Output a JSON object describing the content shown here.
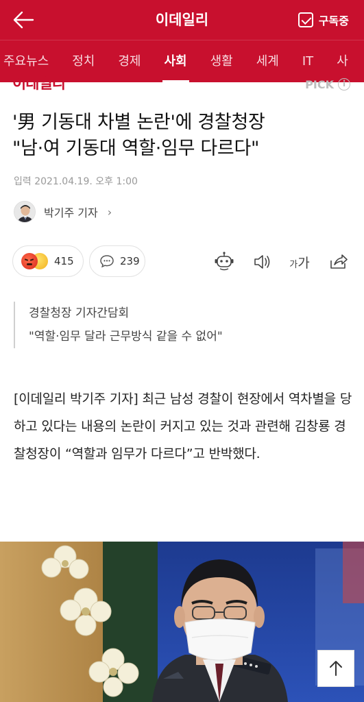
{
  "header": {
    "brand": "이데일리",
    "subscribe_label": "구독중"
  },
  "nav": {
    "items": [
      {
        "label": "주요뉴스",
        "active": false
      },
      {
        "label": "정치",
        "active": false
      },
      {
        "label": "경제",
        "active": false
      },
      {
        "label": "사회",
        "active": true
      },
      {
        "label": "생활",
        "active": false
      },
      {
        "label": "세계",
        "active": false
      },
      {
        "label": "IT",
        "active": false
      },
      {
        "label": "사",
        "active": false
      }
    ]
  },
  "article": {
    "publisher_logo": "이데일리",
    "pick_label": "PICK",
    "title_line1": "'男 기동대 차별 논란'에 경찰청장",
    "title_line2": "\"남·여 기동대 역할·임무 다르다\"",
    "dateline": "입력 2021.04.19. 오후 1:00",
    "reporter": "박기주 기자",
    "reaction_count": "415",
    "comment_count": "239",
    "font_tool_small": "가",
    "font_tool_large": "가",
    "summary_line1": "경찰청장 기자간담회",
    "summary_line2": "\"역할·임무 달라 근무방식 같을 수 없어\"",
    "body": "[이데일리 박기주 기자] 최근 남성 경찰이 현장에서 역차별을 당하고 있다는 내용의 논란이 커지고 있는 것과 관련해 김창룡 경찰청장이 “역할과 임무가 다르다”고 반박했다."
  },
  "colors": {
    "brand_red": "#c8102e",
    "text_dark": "#111111",
    "muted": "#999999"
  },
  "icons": [
    "back-arrow-icon",
    "subscribe-check-icon",
    "info-icon",
    "reaction-emoji-icon",
    "comment-bubble-icon",
    "tts-robot-icon",
    "speaker-icon",
    "font-size-icon",
    "share-icon",
    "scroll-top-icon"
  ]
}
